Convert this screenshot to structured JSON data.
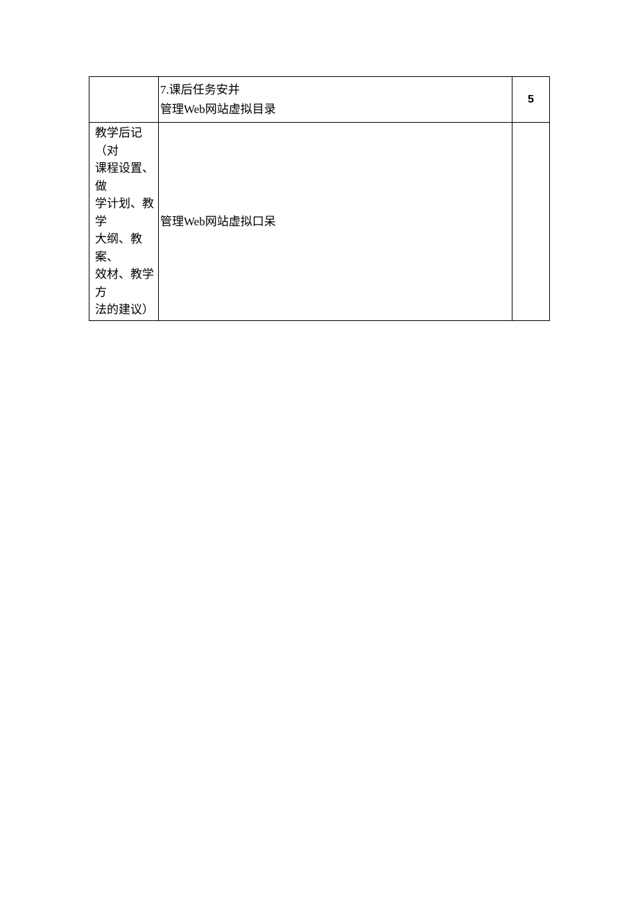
{
  "row1": {
    "cell2_line1": "7.课后任务安并",
    "cell2_line2": "管理Web网站虚拟目录",
    "cell3": "5"
  },
  "row2": {
    "cell1_line1": "教学后记（对",
    "cell1_line2": "课程设置、做",
    "cell1_line3": "学计划、教学",
    "cell1_line4": "大纲、教案、",
    "cell1_line5": "效材、教学方",
    "cell1_line6": "法的建议）",
    "cell2": "管理Web网站虚拟口呆"
  }
}
